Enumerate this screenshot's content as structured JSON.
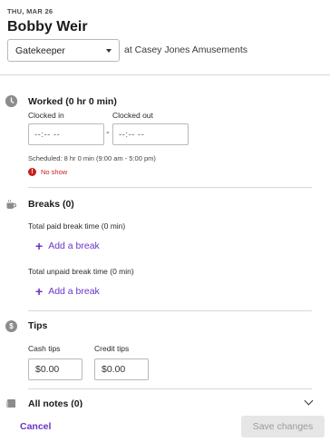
{
  "header": {
    "date": "THU, MAR 26",
    "employee_name": "Bobby Weir",
    "role_selected": "Gatekeeper",
    "location_text": "at Casey Jones Amusements"
  },
  "worked": {
    "icon": "clock-icon",
    "title": "Worked (0 hr 0 min)",
    "clock_in_label": "Clocked in",
    "clock_out_label": "Clocked out",
    "clock_in_value": "--:-- --",
    "clock_out_value": "--:-- --",
    "dash": "-",
    "scheduled_text": "Scheduled: 8 hr 0 min (9:00 am - 5:00 pm)",
    "no_show_text": "No show",
    "no_show_icon": "!"
  },
  "breaks": {
    "icon": "coffee-cup-icon",
    "title": "Breaks (0)",
    "paid_label": "Total paid break time (0 min)",
    "paid_add": "Add a break",
    "unpaid_label": "Total unpaid break time (0 min)",
    "unpaid_add": "Add a break",
    "plus": "+"
  },
  "tips": {
    "icon": "dollar-icon",
    "icon_glyph": "$",
    "title": "Tips",
    "cash_label": "Cash tips",
    "credit_label": "Credit tips",
    "cash_value": "$0.00",
    "credit_value": "$0.00"
  },
  "notes": {
    "icon": "notes-icon",
    "title": "All notes (0)"
  },
  "footer": {
    "cancel_label": "Cancel",
    "save_label": "Save changes"
  },
  "colors": {
    "accent": "#6a35c8",
    "error": "#c62020",
    "disabled_bg": "#e6e6e6",
    "disabled_text": "#9b9b9b"
  }
}
